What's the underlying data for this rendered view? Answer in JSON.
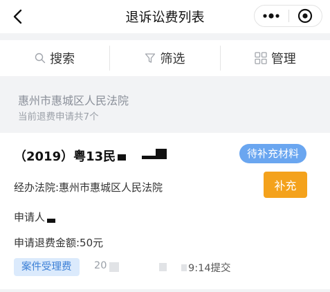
{
  "nav": {
    "title": "退诉讼费列表"
  },
  "toolbar": {
    "search_label": "搜索",
    "filter_label": "筛选",
    "manage_label": "管理"
  },
  "court": {
    "name": "惠州市惠城区人民法院",
    "count_text": "当前退费申请共7个"
  },
  "card": {
    "case_no": "（2019）粤13民",
    "status_badge": "待补充材料",
    "court_line": "经办法院:惠州市惠城区人民法院",
    "supplement_button": "补充",
    "applicant_line": "申请人",
    "amount_line": "申请退费金额:50元",
    "tag": "案件受理费",
    "time_prefix": "20",
    "time_suffix": "9:14提交"
  },
  "colors": {
    "status_badge_bg": "#6aa6f0",
    "supplement_button_bg": "#f4a21c",
    "tag_bg": "#dbeafc",
    "tag_text": "#3b7fd6"
  }
}
